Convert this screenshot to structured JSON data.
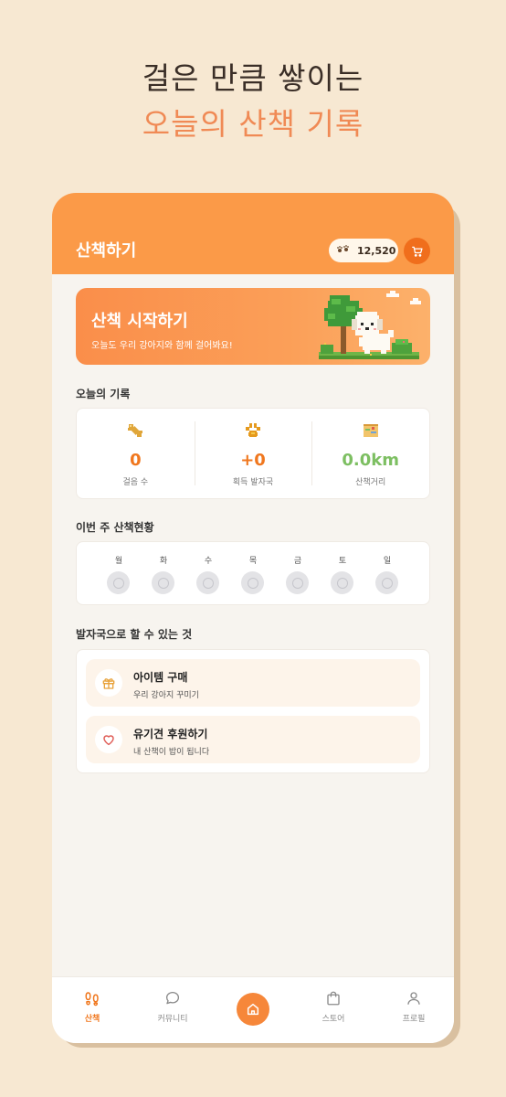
{
  "headline": {
    "line1": "걸은 만큼 쌓이는",
    "line2": "오늘의 산책 기록"
  },
  "colors": {
    "accent": "#FB9A48",
    "accent_dark": "#F06E1C",
    "background": "#F7E8D2",
    "headline_accent": "#F08A55",
    "distance_green": "#7DBF62"
  },
  "appbar": {
    "title": "산책하기",
    "coin_icon": "paw-prints-icon",
    "coins": "12,520",
    "cart_icon": "cart-icon"
  },
  "banner": {
    "title": "산책 시작하기",
    "subtitle": "오늘도 우리 강아지와 함께 걸어봐요!"
  },
  "today": {
    "label": "오늘의 기록",
    "stats": [
      {
        "icon": "bone-icon",
        "value": "0",
        "caption": "걸음 수"
      },
      {
        "icon": "paw-icon",
        "value": "+0",
        "caption": "획득 발자국"
      },
      {
        "icon": "map-icon",
        "value": "0.0km",
        "caption": "산책거리"
      }
    ]
  },
  "week": {
    "label": "이번 주 산책현황",
    "days": [
      "월",
      "화",
      "수",
      "목",
      "금",
      "토",
      "일"
    ]
  },
  "actions": {
    "label": "발자국으로 할 수 있는 것",
    "items": [
      {
        "icon": "gift-icon",
        "title": "아이템 구매",
        "subtitle": "우리 강아지 꾸미기"
      },
      {
        "icon": "heart-icon",
        "title": "유기견 후원하기",
        "subtitle": "내 산책이 밥이 됩니다"
      }
    ]
  },
  "tabs": [
    {
      "icon": "footprints-icon",
      "label": "산책",
      "active": true
    },
    {
      "icon": "chat-bubble-icon",
      "label": "커뮤니티",
      "active": false
    },
    {
      "icon": "home-icon",
      "label": "",
      "active": false
    },
    {
      "icon": "shopping-bag-icon",
      "label": "스토어",
      "active": false
    },
    {
      "icon": "person-icon",
      "label": "프로필",
      "active": false
    }
  ]
}
